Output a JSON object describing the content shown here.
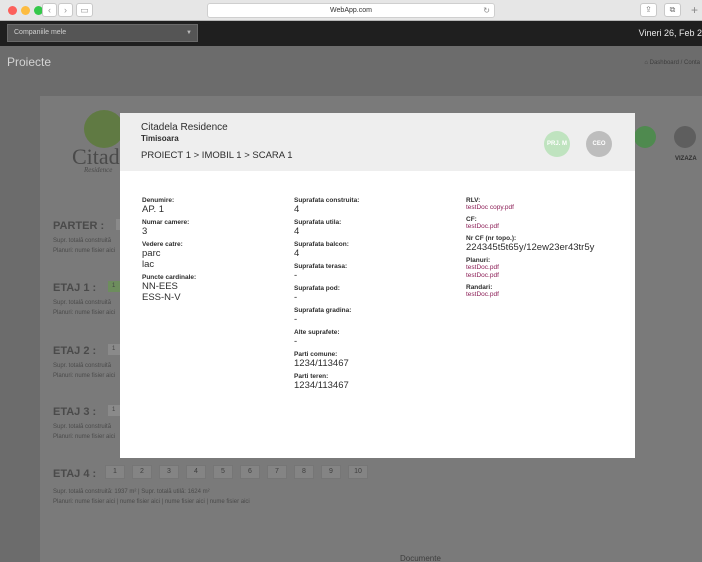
{
  "browser": {
    "url": "WebApp.com"
  },
  "appbar": {
    "company_selector": "Companiile mele",
    "date": "Vineri 26, Feb 2"
  },
  "page": {
    "title": "Proiecte",
    "breadcrumb_home": "Dashboard",
    "breadcrumb_next": "Conta"
  },
  "background": {
    "logo_text": "Citadel",
    "logo_sub": "Residence",
    "side_label": "VIZAZA",
    "documente": "Documente",
    "floors": [
      {
        "label": "PARTER :",
        "info": "Supr. totală construită",
        "plans": "Planuri: nume fisier aici"
      },
      {
        "label": "ETAJ 1 :",
        "info": "Supr. totală construită",
        "plans": "Planuri: nume fisier aici"
      },
      {
        "label": "ETAJ 2 :",
        "info": "Supr. totală construită",
        "plans": "Planuri: nume fisier aici"
      },
      {
        "label": "ETAJ 3 :",
        "info": "Supr. totală construită",
        "plans": "Planuri: nume fisier aici"
      }
    ],
    "etaj4": {
      "label": "ETAJ 4 :",
      "chips": [
        "1",
        "2",
        "3",
        "4",
        "5",
        "6",
        "7",
        "8",
        "9",
        "10"
      ],
      "info": "Supr. totală construită: 1937 m²  |  Supr. totală utilă: 1624 m²",
      "plans": "Planuri: nume fisier aici  |  nume fisier aici  |  nume fisier aici  |  nume fisier aici"
    }
  },
  "modal": {
    "title": "Citadela Residence",
    "city": "Timisoara",
    "path": "PROIECT 1 > IMOBIL 1 > SCARA 1",
    "badges": {
      "pm": "PRJ. M",
      "ceo": "CEO"
    },
    "col1": {
      "denumire_label": "Denumire:",
      "denumire": "AP. 1",
      "camere_label": "Numar camere:",
      "camere": "3",
      "vedere_label": "Vedere catre:",
      "vedere": [
        "parc",
        "lac"
      ],
      "puncte_label": "Puncte cardinale:",
      "puncte": [
        "NN-EES",
        "ESS-N-V"
      ]
    },
    "col2": {
      "construita_label": "Suprafata construita:",
      "construita": "4",
      "utila_label": "Suprafata utila:",
      "utila": "4",
      "balcon_label": "Suprafata balcon:",
      "balcon": "4",
      "terasa_label": "Suprafata terasa:",
      "terasa": "-",
      "pod_label": "Suprafata pod:",
      "pod": "-",
      "gradina_label": "Suprafata gradina:",
      "gradina": "-",
      "alte_label": "Alte suprafete:",
      "alte": "-",
      "comune_label": "Parti comune:",
      "comune": "1234/113467",
      "teren_label": "Parti teren:",
      "teren": "1234/113467"
    },
    "col3": {
      "rlv_label": "RLV:",
      "rlv": "testDoc copy.pdf",
      "cf_label": "CF:",
      "cf": "testDoc.pdf",
      "nrcf_label": "Nr CF (nr topo.):",
      "nrcf": "224345t5t65y/12ew23er43tr5y",
      "planuri_label": "Planuri:",
      "planuri": [
        "testDoc.pdf",
        "testDoc.pdf"
      ],
      "randari_label": "Randari:",
      "randari": "testDoc.pdf"
    }
  }
}
